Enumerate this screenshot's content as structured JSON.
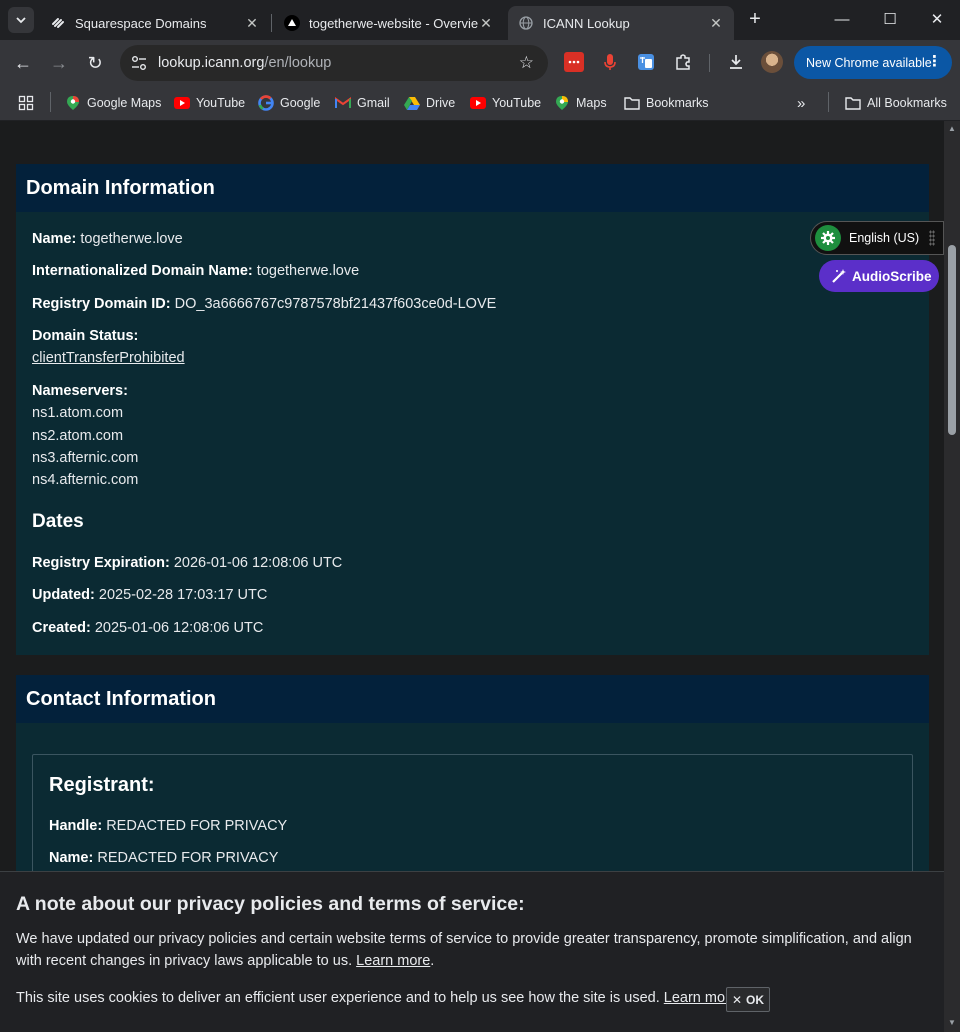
{
  "browser": {
    "tabs": [
      {
        "title": "Squarespace Domains",
        "icon": "squarespace-icon"
      },
      {
        "title": "togetherwe-website - Overview",
        "icon": "vercel-icon"
      },
      {
        "title": "ICANN Lookup",
        "icon": "icann-icon",
        "active": true
      }
    ],
    "url_host": "lookup.icann.org",
    "url_path": "/en/lookup",
    "update_button": "New Chrome available",
    "bookmarks": [
      {
        "label": "Google Maps",
        "icon": "google-maps-icon"
      },
      {
        "label": "YouTube",
        "icon": "youtube-icon"
      },
      {
        "label": "Google",
        "icon": "google-icon"
      },
      {
        "label": "Gmail",
        "icon": "gmail-icon"
      },
      {
        "label": "Drive",
        "icon": "drive-icon"
      },
      {
        "label": "YouTube",
        "icon": "youtube-icon"
      },
      {
        "label": "Maps",
        "icon": "maps-icon"
      },
      {
        "label": "Bookmarks",
        "icon": "folder-icon"
      }
    ],
    "all_bookmarks": "All Bookmarks"
  },
  "domain_info": {
    "heading": "Domain Information",
    "name_label": "Name:",
    "name_value": "togetherwe.love",
    "idn_label": "Internationalized Domain Name:",
    "idn_value": "togetherwe.love",
    "registry_id_label": "Registry Domain ID:",
    "registry_id_value": "DO_3a6666767c9787578bf21437f603ce0d-LOVE",
    "status_label": "Domain Status:",
    "status_value": "clientTransferProhibited",
    "nameservers_label": "Nameservers:",
    "nameservers": [
      "ns1.atom.com",
      "ns2.atom.com",
      "ns3.afternic.com",
      "ns4.afternic.com"
    ],
    "dates_heading": "Dates",
    "expiration_label": "Registry Expiration:",
    "expiration_value": "2026-01-06 12:08:06 UTC",
    "updated_label": "Updated:",
    "updated_value": "2025-02-28 17:03:17 UTC",
    "created_label": "Created:",
    "created_value": "2025-01-06 12:08:06 UTC"
  },
  "contact_info": {
    "heading": "Contact Information",
    "registrant_heading": "Registrant:",
    "handle_label": "Handle:",
    "handle_value": "REDACTED FOR PRIVACY",
    "name_label": "Name:",
    "name_value": "REDACTED FOR PRIVACY"
  },
  "widgets": {
    "language": "English (US)",
    "audioscribe": "AudioScribe"
  },
  "privacy_banner": {
    "title": "A note about our privacy policies and terms of service:",
    "text1": "We have updated our privacy policies and certain website terms of service to provide greater transparency, promote simplification, and align with recent changes in privacy laws applicable to us.",
    "learn_more_1": "Learn more",
    "text2": "This site uses cookies to deliver an efficient user experience and to help us see how the site is used.",
    "learn_more_2": "Learn more.",
    "ok_label": "OK"
  }
}
